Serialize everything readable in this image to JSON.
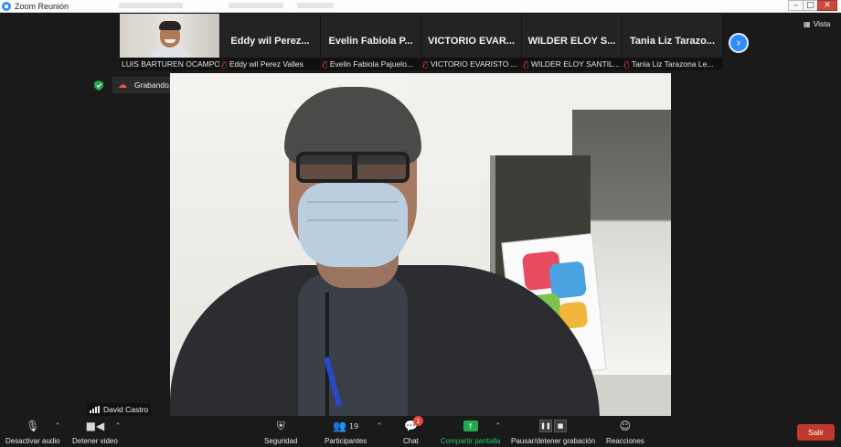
{
  "window": {
    "title": "Zoom Reunión",
    "controls": [
      "–",
      "□",
      "✕"
    ]
  },
  "view_button": {
    "icon": "grid-icon",
    "label": "Vista"
  },
  "participants": [
    {
      "tile_name": "",
      "caption": "LUIS BARTUREN OCAMPO",
      "muted": false,
      "has_video": true
    },
    {
      "tile_name": "Eddy wil Perez...",
      "caption": "Eddy wil Perez Valles",
      "muted": true,
      "has_video": false
    },
    {
      "tile_name": "Evelin Fabiola P...",
      "caption": "Evelin Fabiola Pajuelo...",
      "muted": true,
      "has_video": false
    },
    {
      "tile_name": "VICTORIO EVAR...",
      "caption": "VICTORIO EVARISTO ...",
      "muted": true,
      "has_video": false
    },
    {
      "tile_name": "WILDER ELOY S...",
      "caption": "WILDER ELOY SANTIL...",
      "muted": true,
      "has_video": false
    },
    {
      "tile_name": "Tania Liz Tarazo...",
      "caption": "Tania Liz Tarazona Le...",
      "muted": true,
      "has_video": false
    }
  ],
  "recording": {
    "label": "Grabando...",
    "pause_icon": "❚❚",
    "stop_icon": "■"
  },
  "active_speaker": {
    "name": "David Castro"
  },
  "toolbar": {
    "mute": {
      "label": "Desactivar audio"
    },
    "video": {
      "label": "Detener video"
    },
    "security": {
      "label": "Seguridad"
    },
    "participants": {
      "label": "Participantes",
      "count": "19"
    },
    "chat": {
      "label": "Chat",
      "badge": "1"
    },
    "share": {
      "label": "Compartir pantalla"
    },
    "record": {
      "label": "Pausar/detener grabación"
    },
    "reactions": {
      "label": "Reacciones"
    },
    "leave": {
      "label": "Salir"
    }
  },
  "colors": {
    "accent": "#2d8cff",
    "share": "#22c55e",
    "leave": "#c0392b",
    "muted": "#e84545"
  }
}
